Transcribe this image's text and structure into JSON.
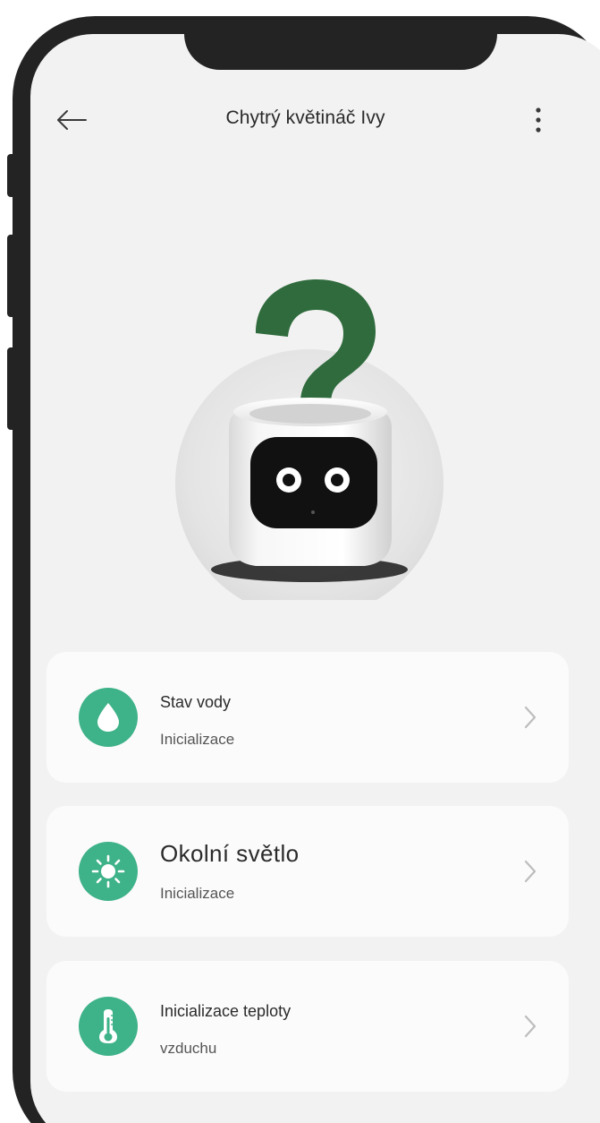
{
  "header": {
    "title": "Chytrý květináč Ivy"
  },
  "icons": {
    "back": "arrow-left-icon",
    "menu": "more-vertical-icon",
    "help": "question-mark-icon",
    "water": "water-drop-icon",
    "light": "sun-icon",
    "temperature": "thermometer-icon",
    "chevron": "chevron-right-icon"
  },
  "colors": {
    "accent": "#3eb289",
    "question_mark": "#2f6b3c",
    "screen_background": "#f2f2f2",
    "card_background": "#fbfbfb",
    "frame": "#232323"
  },
  "status_cards": [
    {
      "title": "Stav vody",
      "subtitle": "Inicializace"
    },
    {
      "title": "Okolní světlo",
      "subtitle": "Inicializace"
    },
    {
      "title": "Inicializace teploty",
      "subtitle": "vzduchu"
    }
  ]
}
